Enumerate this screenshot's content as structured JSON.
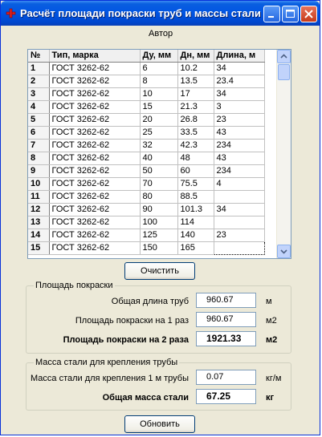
{
  "window": {
    "title": "Расчёт площади покраски труб и массы стали"
  },
  "menu": {
    "items": [
      "Автор"
    ]
  },
  "grid": {
    "columns": [
      "№",
      "Тип, марка",
      "Ду, мм",
      "Дн, мм",
      "Длина, м"
    ],
    "rows": [
      [
        "1",
        "ГОСТ 3262-62",
        "6",
        "10.2",
        "34"
      ],
      [
        "2",
        "ГОСТ 3262-62",
        "8",
        "13.5",
        "23.4"
      ],
      [
        "3",
        "ГОСТ 3262-62",
        "10",
        "17",
        "34"
      ],
      [
        "4",
        "ГОСТ 3262-62",
        "15",
        "21.3",
        "3"
      ],
      [
        "5",
        "ГОСТ 3262-62",
        "20",
        "26.8",
        "23"
      ],
      [
        "6",
        "ГОСТ 3262-62",
        "25",
        "33.5",
        "43"
      ],
      [
        "7",
        "ГОСТ 3262-62",
        "32",
        "42.3",
        "234"
      ],
      [
        "8",
        "ГОСТ 3262-62",
        "40",
        "48",
        "43"
      ],
      [
        "9",
        "ГОСТ 3262-62",
        "50",
        "60",
        "234"
      ],
      [
        "10",
        "ГОСТ 3262-62",
        "70",
        "75.5",
        "4"
      ],
      [
        "11",
        "ГОСТ 3262-62",
        "80",
        "88.5",
        ""
      ],
      [
        "12",
        "ГОСТ 3262-62",
        "90",
        "101.3",
        "34"
      ],
      [
        "13",
        "ГОСТ 3262-62",
        "100",
        "114",
        ""
      ],
      [
        "14",
        "ГОСТ 3262-62",
        "125",
        "140",
        "23"
      ],
      [
        "15",
        "ГОСТ 3262-62",
        "150",
        "165",
        ""
      ]
    ]
  },
  "clear_button": "Очистить",
  "paint_area": {
    "title": "Площадь покраски",
    "total_length_label": "Общая длина труб",
    "total_length_value": "960.67",
    "total_length_unit": "м",
    "area_1_label": "Площадь покраски на 1 раз",
    "area_1_value": "960.67",
    "area_1_unit": "м2",
    "area_2_label": "Площадь покраски на 2 раза",
    "area_2_value": "1921.33",
    "area_2_unit": "м2"
  },
  "steel_mass": {
    "title": "Масса стали для крепления трубы",
    "per_meter_label": "Масса стали для крепления 1 м трубы",
    "per_meter_value": "0.07",
    "per_meter_unit": "кг/м",
    "total_label": "Общая масса стали",
    "total_value": "67.25",
    "total_unit": "кг"
  },
  "update_button": "Обновить"
}
